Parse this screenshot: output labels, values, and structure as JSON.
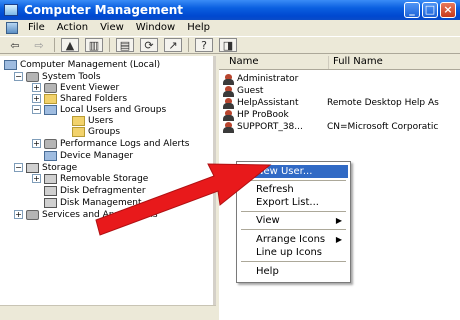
{
  "window": {
    "title": "Computer Management"
  },
  "menubar": {
    "items": [
      "File",
      "Action",
      "View",
      "Window",
      "Help"
    ]
  },
  "tree": {
    "root": "Computer Management (Local)",
    "items": [
      {
        "label": "System Tools"
      },
      {
        "label": "Event Viewer"
      },
      {
        "label": "Shared Folders"
      },
      {
        "label": "Local Users and Groups"
      },
      {
        "label": "Users"
      },
      {
        "label": "Groups"
      },
      {
        "label": "Performance Logs and Alerts"
      },
      {
        "label": "Device Manager"
      },
      {
        "label": "Storage"
      },
      {
        "label": "Removable Storage"
      },
      {
        "label": "Disk Defragmenter"
      },
      {
        "label": "Disk Management"
      },
      {
        "label": "Services and Applications"
      }
    ]
  },
  "list": {
    "columns": [
      "Name",
      "Full Name"
    ],
    "rows": [
      {
        "name": "Administrator",
        "full": ""
      },
      {
        "name": "Guest",
        "full": ""
      },
      {
        "name": "HelpAssistant",
        "full": "Remote Desktop Help As"
      },
      {
        "name": "HP ProBook",
        "full": ""
      },
      {
        "name": "SUPPORT_38...",
        "full": "CN=Microsoft Corporatic"
      }
    ]
  },
  "context_menu": {
    "items": [
      "New User...",
      "Refresh",
      "Export List...",
      "View",
      "Arrange Icons",
      "Line up Icons",
      "Help"
    ]
  },
  "colors": {
    "title_bar": "#0a5fe0",
    "highlight": "#316ac5",
    "annotation_arrow": "#e8191b"
  }
}
